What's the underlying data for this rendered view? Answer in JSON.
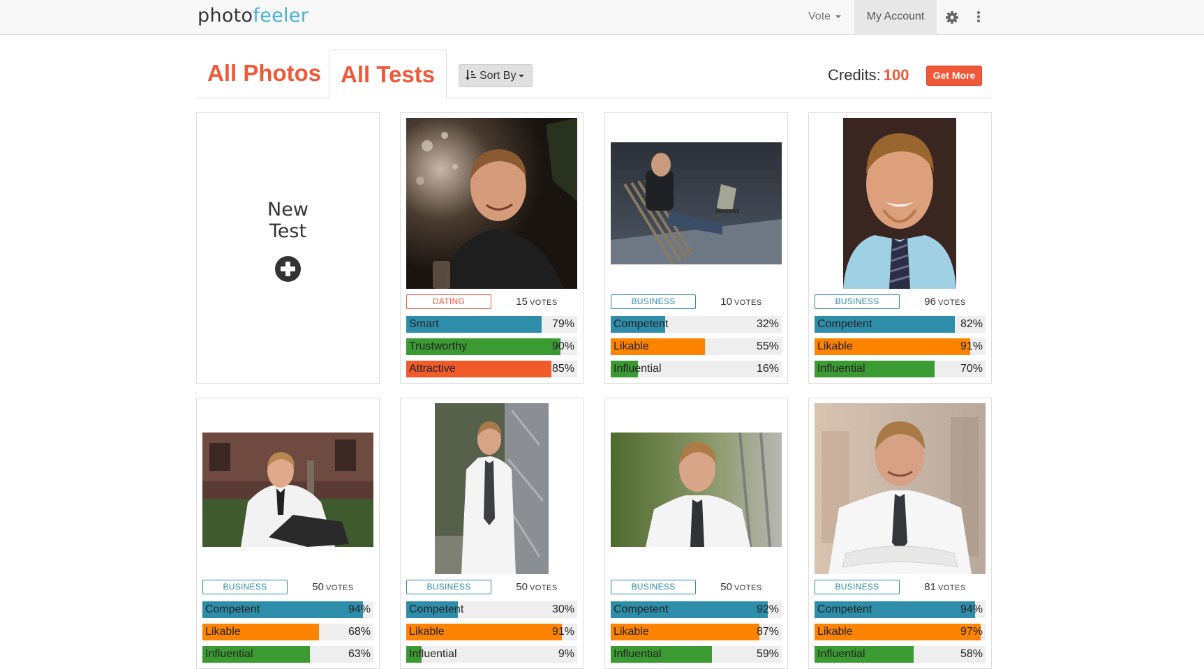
{
  "navbar": {
    "brand_part1": "photo",
    "brand_part2": "feeler",
    "vote_label": "Vote",
    "account_label": "My Account",
    "settings_icon": "gear-icon",
    "more_icon": "vertical-dots-icon"
  },
  "tabs": {
    "photos_label": "All Photos",
    "tests_label": "All Tests",
    "sort_label": "Sort By",
    "active": "All Tests"
  },
  "credits": {
    "label": "Credits:",
    "value": "100",
    "button_label": "Get More"
  },
  "new_test": {
    "line1": "New",
    "line2": "Test"
  },
  "votes_unit": "VOTES",
  "colors": {
    "accent": "#ef5839",
    "teal": "#2e8ea9",
    "orange": "#fe8400",
    "green": "#3c9a33",
    "red": "#f15b2a"
  },
  "tests": [
    {
      "category": "DATING",
      "votes": "15",
      "metrics": [
        {
          "label": "Smart",
          "value": 79,
          "display": "79%",
          "color": "teal"
        },
        {
          "label": "Trustworthy",
          "value": 90,
          "display": "90%",
          "color": "green"
        },
        {
          "label": "Attractive",
          "value": 85,
          "display": "85%",
          "color": "red"
        }
      ]
    },
    {
      "category": "BUSINESS",
      "votes": "10",
      "metrics": [
        {
          "label": "Competent",
          "value": 32,
          "display": "32%",
          "color": "teal"
        },
        {
          "label": "Likable",
          "value": 55,
          "display": "55%",
          "color": "orange"
        },
        {
          "label": "Influential",
          "value": 16,
          "display": "16%",
          "color": "green"
        }
      ]
    },
    {
      "category": "BUSINESS",
      "votes": "96",
      "metrics": [
        {
          "label": "Competent",
          "value": 82,
          "display": "82%",
          "color": "teal"
        },
        {
          "label": "Likable",
          "value": 91,
          "display": "91%",
          "color": "orange"
        },
        {
          "label": "Influential",
          "value": 70,
          "display": "70%",
          "color": "green"
        }
      ]
    },
    {
      "category": "BUSINESS",
      "votes": "50",
      "metrics": [
        {
          "label": "Competent",
          "value": 94,
          "display": "94%",
          "color": "teal"
        },
        {
          "label": "Likable",
          "value": 68,
          "display": "68%",
          "color": "orange"
        },
        {
          "label": "Influential",
          "value": 63,
          "display": "63%",
          "color": "green"
        }
      ]
    },
    {
      "category": "BUSINESS",
      "votes": "50",
      "metrics": [
        {
          "label": "Competent",
          "value": 30,
          "display": "30%",
          "color": "teal"
        },
        {
          "label": "Likable",
          "value": 91,
          "display": "91%",
          "color": "orange"
        },
        {
          "label": "Influential",
          "value": 9,
          "display": "9%",
          "color": "green"
        }
      ]
    },
    {
      "category": "BUSINESS",
      "votes": "50",
      "metrics": [
        {
          "label": "Competent",
          "value": 92,
          "display": "92%",
          "color": "teal"
        },
        {
          "label": "Likable",
          "value": 87,
          "display": "87%",
          "color": "orange"
        },
        {
          "label": "Influential",
          "value": 59,
          "display": "59%",
          "color": "green"
        }
      ]
    },
    {
      "category": "BUSINESS",
      "votes": "81",
      "metrics": [
        {
          "label": "Competent",
          "value": 94,
          "display": "94%",
          "color": "teal"
        },
        {
          "label": "Likable",
          "value": 97,
          "display": "97%",
          "color": "orange"
        },
        {
          "label": "Influential",
          "value": 58,
          "display": "58%",
          "color": "green"
        }
      ]
    }
  ]
}
